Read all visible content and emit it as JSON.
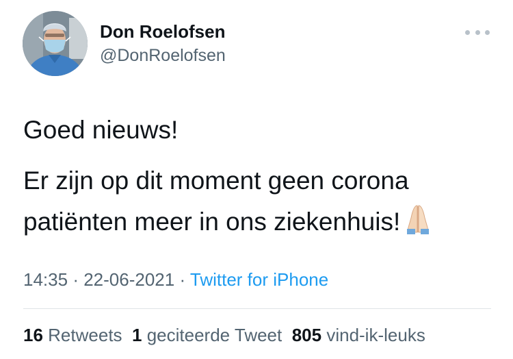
{
  "author": {
    "name": "Don Roelofsen",
    "handle": "@DonRoelofsen"
  },
  "tweet": {
    "line1": "Goed nieuws!",
    "line2": "Er zijn op dit moment geen corona patiënten meer in ons ziekenhuis!",
    "emoji": "folded-hands-icon"
  },
  "meta": {
    "time": "14:35",
    "sep1": "·",
    "date": "22-06-2021",
    "sep2": "·",
    "source": "Twitter for iPhone"
  },
  "stats": {
    "retweets_count": "16",
    "retweets_label": "Retweets",
    "quotes_count": "1",
    "quotes_label": "geciteerde Tweet",
    "likes_count": "805",
    "likes_label": "vind-ik-leuks"
  },
  "colors": {
    "text": "#0f1419",
    "secondary": "#536471",
    "link": "#1d9bf0"
  }
}
